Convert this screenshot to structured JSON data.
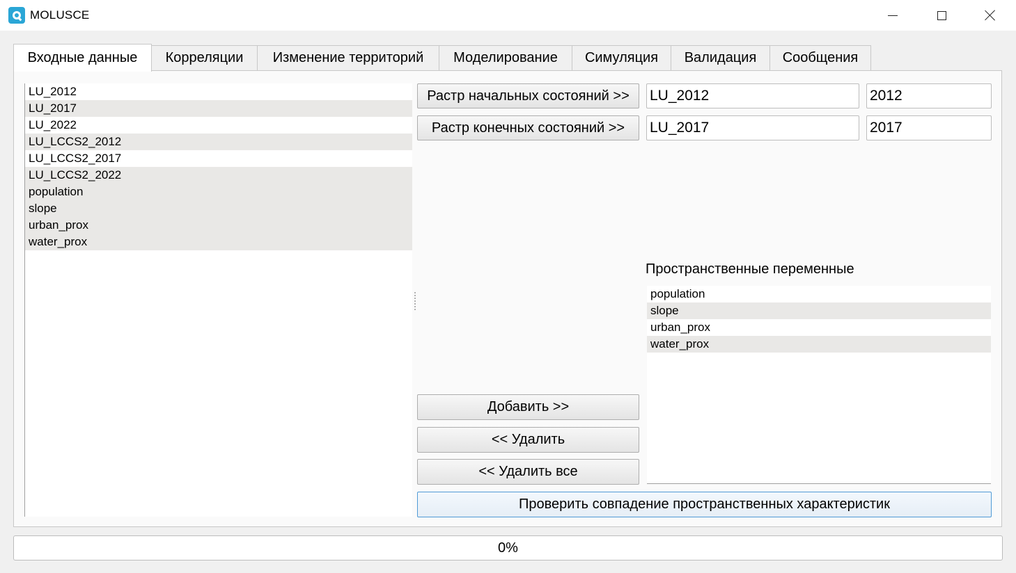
{
  "window": {
    "title": "MOLUSCE",
    "icon": "q-logo-icon"
  },
  "tabs": [
    {
      "label": "Входные данные",
      "active": true
    },
    {
      "label": "Корреляции"
    },
    {
      "label": "Изменение территорий"
    },
    {
      "label": "Моделирование"
    },
    {
      "label": "Симуляция"
    },
    {
      "label": "Валидация"
    },
    {
      "label": "Сообщения"
    }
  ],
  "layers_list": [
    "LU_2012",
    "LU_2017",
    "LU_2022",
    "LU_LCCS2_2012",
    "LU_LCCS2_2017",
    "LU_LCCS2_2022",
    "population",
    "slope",
    "urban_prox",
    "water_prox"
  ],
  "initial_state": {
    "button": "Растр начальных состояний >>",
    "layer": "LU_2012",
    "year": "2012"
  },
  "final_state": {
    "button": "Растр конечных состояний >>",
    "layer": "LU_2017",
    "year": "2017"
  },
  "spatial_vars": {
    "label": "Пространственные переменные",
    "items": [
      "population",
      "slope",
      "urban_prox",
      "water_prox"
    ]
  },
  "actions": {
    "add": "Добавить >>",
    "remove": "<< Удалить",
    "remove_all": "<< Удалить все",
    "check": "Проверить совпадение пространственных характеристик"
  },
  "progress": {
    "text": "0%",
    "value": 0
  },
  "colors": {
    "accent": "#2aa6d6",
    "row_alt": "#e9e8e6",
    "primary_border": "#4f9ad6"
  }
}
